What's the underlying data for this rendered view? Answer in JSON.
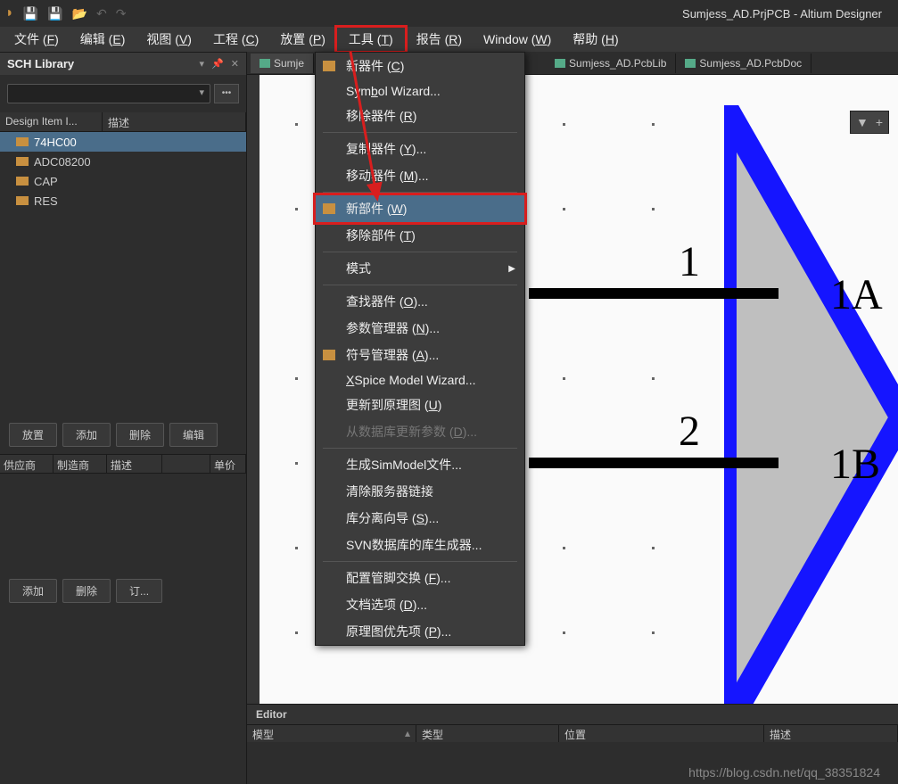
{
  "title": "Sumjess_AD.PrjPCB - Altium Designer",
  "menubar": {
    "file": "文件 (F)",
    "edit": "编辑 (E)",
    "view": "视图 (V)",
    "project": "工程 (C)",
    "place": "放置 (P)",
    "tools": "工具 (T)",
    "report": "报告 (R)",
    "window": "Window (W)",
    "help": "帮助 (H)"
  },
  "panel": {
    "title": "SCH Library"
  },
  "list": {
    "col1": "Design Item I...",
    "col2": "描述",
    "items": [
      "74HC00",
      "ADC08200",
      "CAP",
      "RES"
    ]
  },
  "buttons": {
    "place": "放置",
    "add": "添加",
    "delete": "删除",
    "edit": "编辑"
  },
  "grid": {
    "c1": "供应商",
    "c2": "制造商",
    "c3": "描述",
    "c4": "",
    "c5": "单价"
  },
  "buttons2": {
    "add": "添加",
    "delete": "删除",
    "order": "订..."
  },
  "tabs": {
    "t1": "Sumje",
    "t2": "Sumjess_AD.PcbLib",
    "t3": "Sumjess_AD.PcbDoc"
  },
  "pins": {
    "n1": "1",
    "n2": "2",
    "l1": "1A",
    "l2": "1B"
  },
  "dropdown": {
    "m1": "新器件 (C)",
    "m2": "Symbol Wizard...",
    "m3": "移除器件 (R)",
    "m4": "复制器件 (Y)...",
    "m5": "移动器件 (M)...",
    "m6": "新部件 (W)",
    "m7": "移除部件 (T)",
    "m8": "模式",
    "m9": "查找器件 (O)...",
    "m10": "参数管理器 (N)...",
    "m11": "符号管理器 (A)...",
    "m12": "XSpice Model Wizard...",
    "m13": "更新到原理图 (U)",
    "m14": "从数据库更新参数 (D)...",
    "m15": "生成SimModel文件...",
    "m16": "清除服务器链接",
    "m17": "库分离向导 (S)...",
    "m18": "SVN数据库的库生成器...",
    "m19": "配置管脚交换 (F)...",
    "m20": "文档选项 (D)...",
    "m21": "原理图优先项 (P)..."
  },
  "editor": {
    "title": "Editor",
    "c1": "模型",
    "c2": "类型",
    "c3": "位置",
    "c4": "描述"
  },
  "watermark": "https://blog.csdn.net/qq_38351824"
}
